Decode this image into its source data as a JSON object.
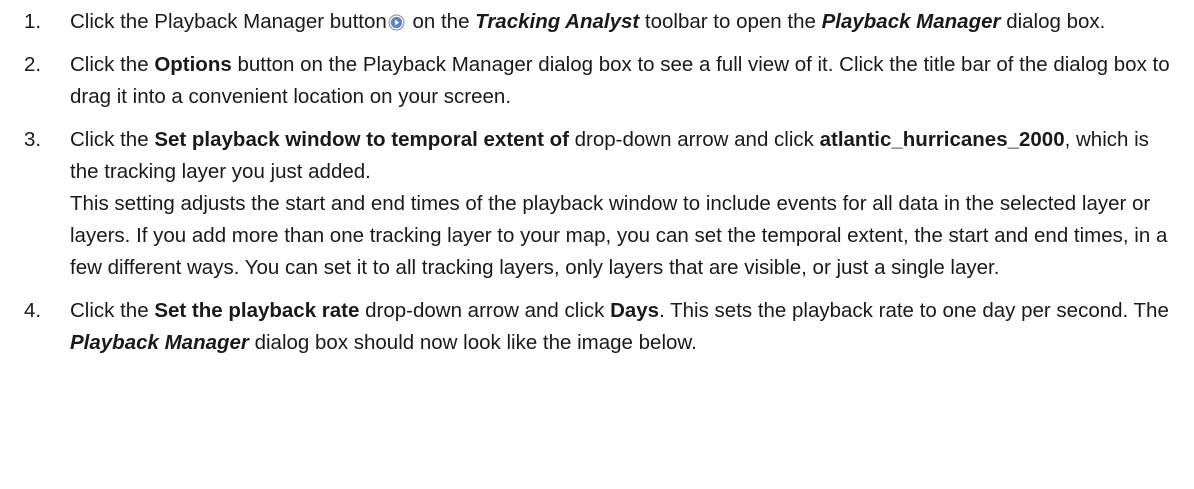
{
  "steps": [
    {
      "number": "1.",
      "p1": "Click the Playback Manager button",
      "icon": "play-circle-icon",
      "p2": " on the ",
      "toolbar_name": "Tracking Analyst",
      "p3": " toolbar to open the ",
      "dialog_name": "Playback Manager",
      "p4": " dialog box."
    },
    {
      "number": "2.",
      "p1": "Click the ",
      "options_label": "Options",
      "p2": " button on the Playback Manager dialog box to see a full view of it. Click the title bar of the dialog box to drag it into a convenient location on your screen."
    },
    {
      "number": "3.",
      "p1": "Click the ",
      "setting_label": "Set playback window to temporal extent of",
      "p2": " drop-down arrow and click ",
      "layer_name": "atlantic_hurricanes_2000",
      "p3": ", which is the tracking layer you just added.",
      "note": "This setting adjusts the start and end times of the playback window to include events for all data in the selected layer or layers. If you add more than one tracking layer to your map, you can set the temporal extent, the start and end times, in a few different ways. You can set it to all tracking layers, only layers that are visible, or just a single layer."
    },
    {
      "number": "4.",
      "p1": "Click the ",
      "rate_label": "Set the playback rate",
      "p2": " drop-down arrow and click ",
      "rate_value": "Days",
      "p3": ". This sets the playback rate to one day per second. The ",
      "dialog_name": "Playback Manager",
      "p4": " dialog box should now look like the image below."
    }
  ],
  "colors": {
    "text": "#1a1a1a",
    "icon_fill": "#5b86c6",
    "icon_border": "#8a8a8a"
  }
}
